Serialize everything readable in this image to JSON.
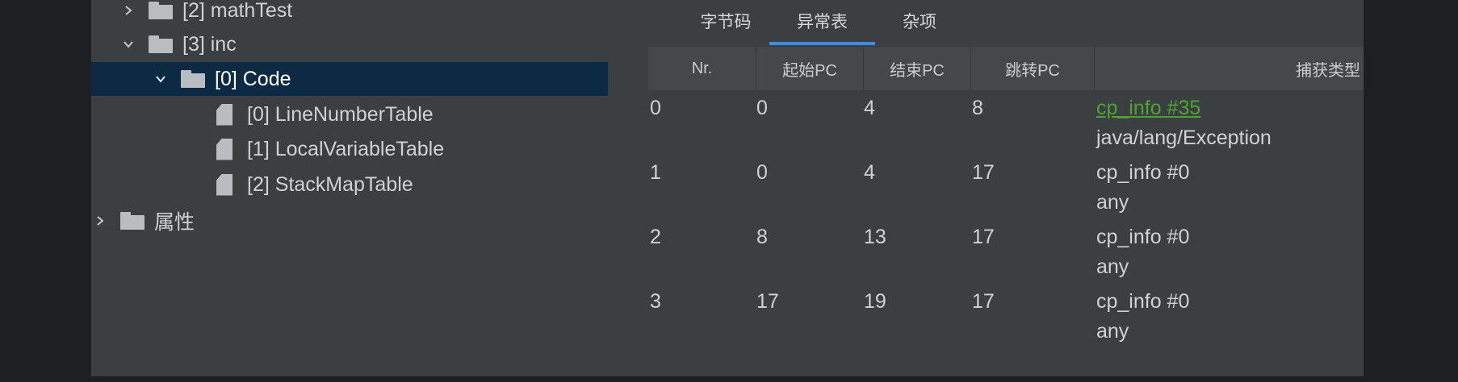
{
  "tree": {
    "items": [
      {
        "label": "[2] mathTest"
      },
      {
        "label": "[3] inc"
      },
      {
        "label": "[0] Code"
      },
      {
        "label": "[0] LineNumberTable"
      },
      {
        "label": "[1] LocalVariableTable"
      },
      {
        "label": "[2] StackMapTable"
      },
      {
        "label": "属性"
      }
    ]
  },
  "tabs": [
    {
      "label": "字节码"
    },
    {
      "label": "异常表"
    },
    {
      "label": "杂项"
    }
  ],
  "table": {
    "columns": [
      "Nr.",
      "起始PC",
      "结束PC",
      "跳转PC",
      "捕获类型"
    ],
    "rows": [
      {
        "nr": "0",
        "start": "0",
        "end": "4",
        "handler": "8",
        "type_ref": "cp_info #35",
        "type_name": "java/lang/Exception"
      },
      {
        "nr": "1",
        "start": "0",
        "end": "4",
        "handler": "17",
        "type_ref": "cp_info #0",
        "type_name": "any"
      },
      {
        "nr": "2",
        "start": "8",
        "end": "13",
        "handler": "17",
        "type_ref": "cp_info #0",
        "type_name": "any"
      },
      {
        "nr": "3",
        "start": "17",
        "end": "19",
        "handler": "17",
        "type_ref": "cp_info #0",
        "type_name": "any"
      }
    ]
  },
  "colors": {
    "background": "#3c3f41",
    "selection": "#0d2a44",
    "tab_accent": "#3d8ee3",
    "link": "#4ca62d"
  }
}
